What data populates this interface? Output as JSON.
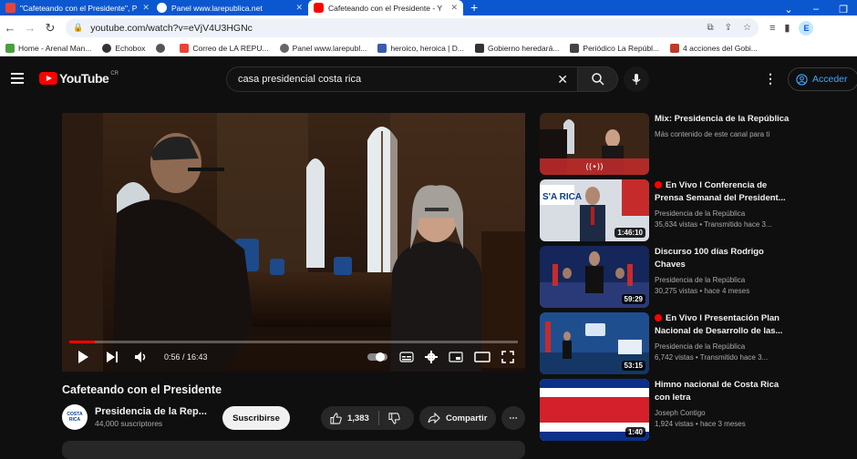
{
  "browser": {
    "tabs": [
      {
        "title": "\"Cafeteando con el Presidente\", P",
        "color": "#ea4335"
      },
      {
        "title": "Panel www.larepublica.net",
        "color": "#ffffff"
      },
      {
        "title": "Cafeteando con el Presidente - Y",
        "color": "#ff0000"
      }
    ],
    "url": "youtube.com/watch?v=eVjV4U3HGNc",
    "profile_initial": "E",
    "bookmarks": [
      {
        "label": "Home - Arenal Man...",
        "color": "#4b9e3f"
      },
      {
        "label": "Echobox",
        "color": "#333333"
      },
      {
        "label": "",
        "color": "#555555"
      },
      {
        "label": "Correo de LA REPU...",
        "color": "#ea4335"
      },
      {
        "label": "Panel www.larepubl...",
        "color": "#666666"
      },
      {
        "label": "heroico, heroica | D...",
        "color": "#3b5bab"
      },
      {
        "label": "Gobierno heredará...",
        "color": "#333333"
      },
      {
        "label": "Periódico La Repúbl...",
        "color": "#444444"
      },
      {
        "label": "4 acciones del Gobi...",
        "color": "#c0392b"
      }
    ]
  },
  "youtube": {
    "logo_word": "YouTube",
    "country_code": "CR",
    "search_query": "casa presidencial costa rica",
    "signin_label": "Acceder"
  },
  "player": {
    "time": "0:56 / 16:43",
    "progress_fraction": 0.056
  },
  "video": {
    "title": "Cafeteando con el Presidente",
    "channel_name": "Presidencia de la Rep...",
    "subscribers": "44,000 suscriptores",
    "subscribe_label": "Suscribirse",
    "likes": "1,383",
    "share_label": "Compartir",
    "avatar_text": "COSTA RICA"
  },
  "recommendations": [
    {
      "title": "Mix: Presidencia de la República",
      "meta1": "Más contenido de este canal para ti",
      "meta2": "",
      "duration": "",
      "live": false
    },
    {
      "title": "En Vivo l Conferencia de Prensa Semanal del President...",
      "meta1": "Presidencia de la República",
      "meta2": "35,634 vistas • Transmitido hace 3...",
      "duration": "1:46:10",
      "live": true
    },
    {
      "title": "Discurso 100 días Rodrigo Chaves",
      "meta1": "Presidencia de la República",
      "meta2": "30,275 vistas • hace 4 meses",
      "duration": "59:29",
      "live": false
    },
    {
      "title": "En Vivo l Presentación Plan Nacional de Desarrollo de las...",
      "meta1": "Presidencia de la República",
      "meta2": "6,742 vistas • Transmitido hace 3...",
      "duration": "53:15",
      "live": true
    },
    {
      "title": "Himno nacional de Costa Rica con letra",
      "meta1": "Joseph Contigo",
      "meta2": "1,924 vistas • hace 3 meses",
      "duration": "1:40",
      "live": false
    }
  ],
  "thumb_texts": {
    "rec1_banner": "S'A RICA"
  }
}
